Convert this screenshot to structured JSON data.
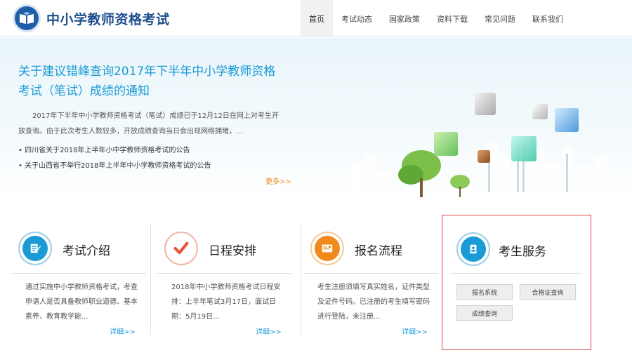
{
  "header": {
    "site_title": "中小学教师资格考试",
    "nav": [
      {
        "label": "首页",
        "active": true
      },
      {
        "label": "考试动态",
        "active": false
      },
      {
        "label": "国家政策",
        "active": false
      },
      {
        "label": "资料下载",
        "active": false
      },
      {
        "label": "常见问题",
        "active": false
      },
      {
        "label": "联系我们",
        "active": false
      }
    ]
  },
  "banner": {
    "headline": "关于建议错峰查询2017年下半年中小学教师资格考试（笔试）成绩的通知",
    "summary": "2017年下半年中小学教师资格考试（笔试）成绩已于12月12日在网上对考生开放查询。由于此次考生人数较多，开放成绩查询当日会出现网络拥堵，...",
    "news": [
      "四川省关于2018年上半年小中学教师资格考试的公告",
      "关于山西省不举行2018年上半年中小学教师资格考试的公告"
    ],
    "more_label": "更多>>"
  },
  "cards": [
    {
      "title": "考试介绍",
      "text": "通过实施中小学教师资格考试，考查申请人是否具备教师职业道德、基本素养、教育教学能...",
      "more": "详细>>",
      "accent": "#1a9ad6"
    },
    {
      "title": "日程安排",
      "text": "2018年中小学教师资格考试日程安排：上半年笔试3月17日，面试日期：5月19日...",
      "more": "详细>>",
      "accent": "#e8553a"
    },
    {
      "title": "报名流程",
      "text": "考生注册须填写真实姓名，证件类型及证件号码。已注册的考生填写密码进行登陆，未注册...",
      "more": "详细>>",
      "accent": "#f08a1c"
    }
  ],
  "service": {
    "title": "考生服务",
    "accent": "#1a9ad6",
    "buttons": [
      "报名系统",
      "合格证查询",
      "成绩查询"
    ]
  }
}
